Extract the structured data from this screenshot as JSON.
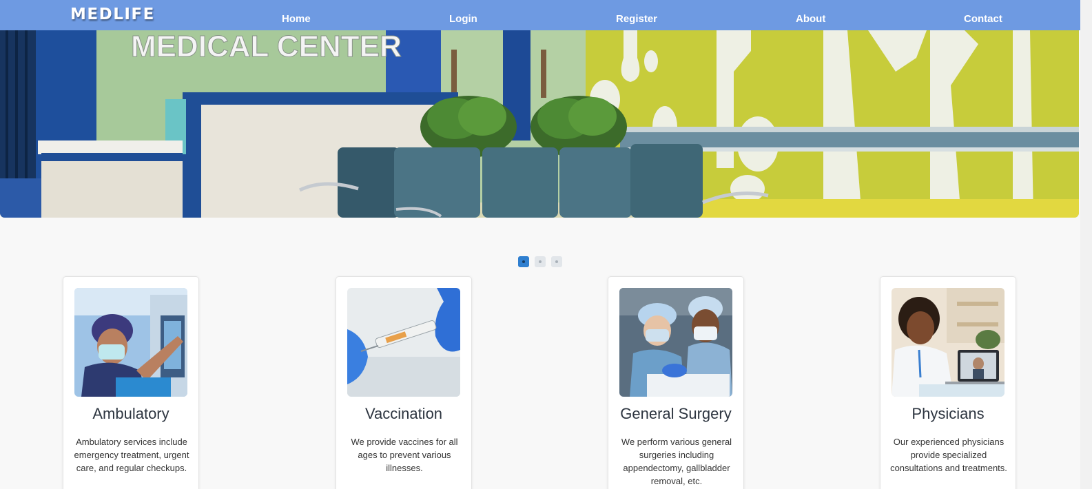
{
  "navbar": {
    "brand": "MEDLIFE",
    "links": [
      {
        "label": "Home"
      },
      {
        "label": "Login"
      },
      {
        "label": "Register"
      },
      {
        "label": "About"
      },
      {
        "label": "Contact"
      }
    ],
    "background_color": "#6e9ae2"
  },
  "hero": {
    "sign_text": "MEDICAL CENTER",
    "carousel_slides": 3,
    "active_slide": 1
  },
  "cards": [
    {
      "title": "Ambulatory",
      "description": "Ambulatory services include emergency treatment, urgent care, and regular checkups.",
      "image": "nurse-monitor-image"
    },
    {
      "title": "Vaccination",
      "description": "We provide vaccines for all ages to prevent various illnesses.",
      "image": "syringe-image"
    },
    {
      "title": "General Surgery",
      "description": "We perform various general surgeries including appendectomy, gallbladder removal, etc.",
      "image": "surgeons-image"
    },
    {
      "title": "Physicians",
      "description": "Our experienced physicians provide specialized consultations and treatments.",
      "image": "physician-laptop-image"
    }
  ],
  "colors": {
    "accent": "#6e9ae2",
    "active_dot": "#2f7fd0",
    "page_background": "#f8f8f8"
  }
}
